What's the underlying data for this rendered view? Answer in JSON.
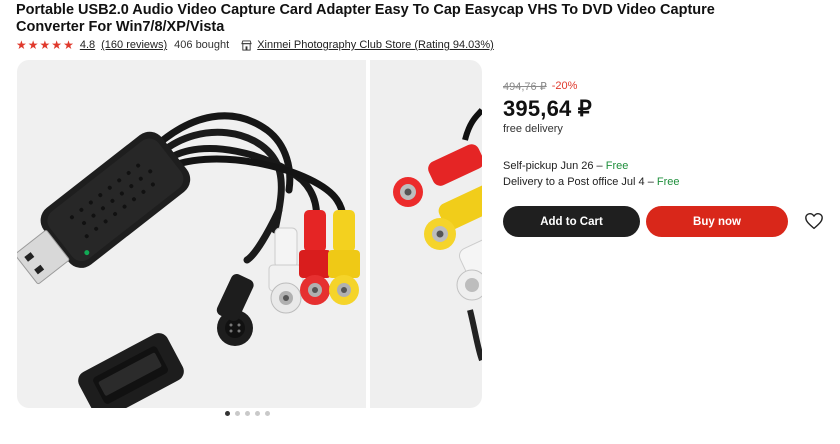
{
  "product": {
    "title": "Portable USB2.0 Audio Video Capture Card Adapter Easy To Cap Easycap VHS To DVD Video Capture Converter For Win7/8/XP/Vista",
    "rating": "4.8",
    "stars": 5,
    "reviews": "(160 reviews)",
    "bought": "406 bought",
    "store": "Xinmei Photography Club Store (Rating 94.03%)"
  },
  "gallery": {
    "image_count": 5,
    "active_index": 0
  },
  "pricing": {
    "old_price": "494,76 ₽",
    "discount": "-20%",
    "price": "395,64 ₽",
    "free_delivery": "free delivery"
  },
  "delivery": {
    "pickup_label": "Self-pickup Jun 26 –",
    "pickup_price": "Free",
    "post_label": "Delivery to a Post office Jul 4 –",
    "post_price": "Free"
  },
  "actions": {
    "add_to_cart": "Add to Cart",
    "buy_now": "Buy now"
  },
  "colors": {
    "accent_red": "#d9271a",
    "dark_button": "#1f1f1f",
    "free_green": "#1f8f3c"
  },
  "icons": {
    "store": "store-icon",
    "wishlist": "heart-icon",
    "rating": "star-icon"
  }
}
